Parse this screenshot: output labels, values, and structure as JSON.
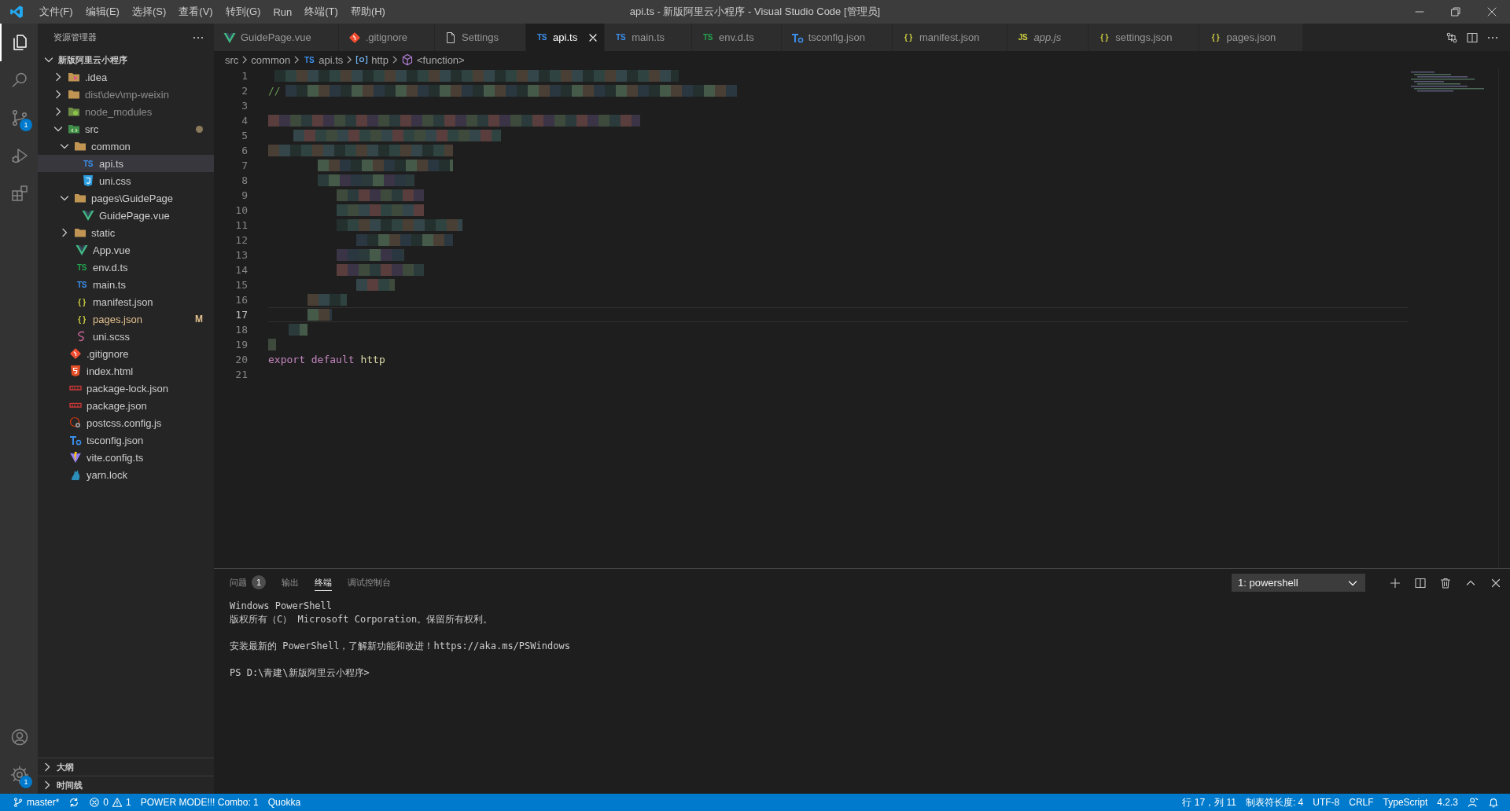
{
  "window": {
    "title": "api.ts - 新版阿里云小程序 - Visual Studio Code [管理员]"
  },
  "menu": [
    "文件(F)",
    "编辑(E)",
    "选择(S)",
    "查看(V)",
    "转到(G)",
    "Run",
    "终端(T)",
    "帮助(H)"
  ],
  "activity_bar": {
    "items": [
      {
        "kind": "explorer",
        "selected": true
      },
      {
        "kind": "search",
        "selected": false
      },
      {
        "kind": "source_control",
        "selected": false,
        "badge": "1"
      },
      {
        "kind": "run_debug",
        "selected": false
      },
      {
        "kind": "extensions",
        "selected": false
      }
    ],
    "bottom": [
      {
        "kind": "account"
      },
      {
        "kind": "settings",
        "badge": "1"
      }
    ]
  },
  "sidebar": {
    "title": "资源管理器",
    "tree": {
      "label": "新版阿里云小程序",
      "expanded": true,
      "selected": false,
      "children": [
        {
          "label": ".idea",
          "icon": {
            "kind": "folder-idea"
          },
          "expanded": false,
          "selected": false
        },
        {
          "label": "dist\\dev\\mp-weixin",
          "icon": {
            "kind": "folder"
          },
          "expanded": false,
          "selected": false,
          "ignored": true
        },
        {
          "label": "node_modules",
          "icon": {
            "kind": "folder-node"
          },
          "expanded": false,
          "selected": false,
          "ignored": true
        },
        {
          "label": "src",
          "icon": {
            "kind": "folder-src"
          },
          "expanded": true,
          "selected": false,
          "has_changes": true,
          "children": [
            {
              "label": "common",
              "icon": {
                "kind": "folder"
              },
              "expanded": true,
              "selected": false,
              "children": [
                {
                  "label": "api.ts",
                  "icon": {
                    "kind": "text",
                    "text": "TS",
                    "color": "#3b8eea"
                  },
                  "selected": true
                },
                {
                  "label": "uni.css",
                  "icon": {
                    "kind": "css"
                  },
                  "selected": false
                }
              ]
            },
            {
              "label": "pages\\GuidePage",
              "icon": {
                "kind": "folder"
              },
              "expanded": true,
              "selected": false,
              "children": [
                {
                  "label": "GuidePage.vue",
                  "icon": {
                    "kind": "vue"
                  },
                  "selected": false
                }
              ]
            },
            {
              "label": "static",
              "icon": {
                "kind": "folder"
              },
              "expanded": false,
              "selected": false
            },
            {
              "label": "App.vue",
              "icon": {
                "kind": "vue"
              },
              "selected": false
            },
            {
              "label": "env.d.ts",
              "icon": {
                "kind": "text",
                "text": "TS",
                "color": "#23a24d"
              },
              "selected": false
            },
            {
              "label": "main.ts",
              "icon": {
                "kind": "text",
                "text": "TS",
                "color": "#3b8eea"
              },
              "selected": false
            },
            {
              "label": "manifest.json",
              "icon": {
                "kind": "text",
                "text": "{ }",
                "color": "#cbcb41"
              },
              "selected": false
            },
            {
              "label": "pages.json",
              "icon": {
                "kind": "text",
                "text": "{ }",
                "color": "#cbcb41"
              },
              "selected": false,
              "modified": true,
              "badge": "M"
            },
            {
              "label": "uni.scss",
              "icon": {
                "kind": "scss"
              },
              "selected": false
            }
          ]
        },
        {
          "label": ".gitignore",
          "icon": {
            "kind": "git"
          },
          "selected": false
        },
        {
          "label": "index.html",
          "icon": {
            "kind": "html"
          },
          "selected": false
        },
        {
          "label": "package-lock.json",
          "icon": {
            "kind": "npm"
          },
          "selected": false
        },
        {
          "label": "package.json",
          "icon": {
            "kind": "npm"
          },
          "selected": false
        },
        {
          "label": "postcss.config.js",
          "icon": {
            "kind": "postcss"
          },
          "selected": false
        },
        {
          "label": "tsconfig.json",
          "icon": {
            "kind": "tsconfig"
          },
          "selected": false
        },
        {
          "label": "vite.config.ts",
          "icon": {
            "kind": "vite"
          },
          "selected": false
        },
        {
          "label": "yarn.lock",
          "icon": {
            "kind": "yarn"
          },
          "selected": false
        }
      ]
    },
    "sections": [
      {
        "label": "大纲",
        "expanded": false
      },
      {
        "label": "时间线",
        "expanded": false
      }
    ]
  },
  "tabs": [
    {
      "label": "GuidePage.vue",
      "icon": {
        "kind": "vue"
      },
      "selected": false,
      "preview": false
    },
    {
      "label": ".gitignore",
      "icon": {
        "kind": "git"
      },
      "selected": false,
      "preview": false
    },
    {
      "label": "Settings",
      "icon": {
        "kind": "file"
      },
      "selected": false,
      "preview": false
    },
    {
      "label": "api.ts",
      "icon": {
        "kind": "text",
        "text": "TS",
        "color": "#3b8eea"
      },
      "selected": true,
      "preview": false
    },
    {
      "label": "main.ts",
      "icon": {
        "kind": "text",
        "text": "TS",
        "color": "#3b8eea"
      },
      "selected": false,
      "preview": false
    },
    {
      "label": "env.d.ts",
      "icon": {
        "kind": "text",
        "text": "TS",
        "color": "#23a24d"
      },
      "selected": false,
      "preview": false
    },
    {
      "label": "tsconfig.json",
      "icon": {
        "kind": "tsconfig"
      },
      "selected": false,
      "preview": false
    },
    {
      "label": "manifest.json",
      "icon": {
        "kind": "text",
        "text": "{ }",
        "color": "#cbcb41"
      },
      "selected": false,
      "preview": false
    },
    {
      "label": "app.js",
      "icon": {
        "kind": "text",
        "text": "JS",
        "color": "#cbcb41"
      },
      "selected": false,
      "preview": true
    },
    {
      "label": "settings.json",
      "icon": {
        "kind": "text",
        "text": "{ }",
        "color": "#cbcb41"
      },
      "selected": false,
      "preview": false
    },
    {
      "label": "pages.json",
      "icon": {
        "kind": "text",
        "text": "{ }",
        "color": "#cbcb41"
      },
      "selected": false,
      "preview": false
    }
  ],
  "breadcrumb": [
    {
      "text": "src"
    },
    {
      "text": "common"
    },
    {
      "text": "api.ts",
      "icon": {
        "kind": "text",
        "text": "TS",
        "color": "#3b8eea"
      }
    },
    {
      "text": "http",
      "icon": {
        "kind": "variable"
      }
    },
    {
      "text": "<function>",
      "icon": {
        "kind": "method"
      }
    }
  ],
  "editor": {
    "lines": [
      {
        "number": "1",
        "current": false
      },
      {
        "number": "2",
        "current": false,
        "tokens": [
          {
            "text": "//",
            "kind": "comment"
          }
        ]
      },
      {
        "number": "3",
        "current": false
      },
      {
        "number": "4",
        "current": false
      },
      {
        "number": "5",
        "current": false
      },
      {
        "number": "6",
        "current": false
      },
      {
        "number": "7",
        "current": false
      },
      {
        "number": "8",
        "current": false
      },
      {
        "number": "9",
        "current": false
      },
      {
        "number": "10",
        "current": false
      },
      {
        "number": "11",
        "current": false
      },
      {
        "number": "12",
        "current": false
      },
      {
        "number": "13",
        "current": false
      },
      {
        "number": "14",
        "current": false
      },
      {
        "number": "15",
        "current": false
      },
      {
        "number": "16",
        "current": false
      },
      {
        "number": "17",
        "current": true
      },
      {
        "number": "18",
        "current": false
      },
      {
        "number": "19",
        "current": false
      },
      {
        "number": "20",
        "current": false,
        "tokens": [
          {
            "text": "export",
            "kind": "keyword"
          },
          {
            "text": "default",
            "kind": "keyword"
          },
          {
            "text": "http",
            "kind": "variable"
          }
        ]
      },
      {
        "number": "21",
        "current": false
      }
    ]
  },
  "panel": {
    "tabs": [
      {
        "label": "问题",
        "badge": "1",
        "selected": false
      },
      {
        "label": "输出",
        "selected": false
      },
      {
        "label": "终端",
        "selected": true
      },
      {
        "label": "调试控制台",
        "selected": false
      }
    ],
    "terminal_select": "1: powershell",
    "terminal": [
      [
        "Windows PowerShell",
        "版权所有（C） Microsoft Corporation。保留所有权利。"
      ],
      [
        "安装最新的 PowerShell，了解新功能和改进！https://aka.ms/PSWindows"
      ],
      [
        "PS D:\\青建\\新版阿里云小程序>"
      ]
    ]
  },
  "status_bar": {
    "left": [
      {
        "kind": "branch",
        "text": "master*"
      },
      {
        "kind": "sync"
      },
      {
        "kind": "problems",
        "errors": "0",
        "warnings": "1"
      },
      {
        "kind": "text",
        "text": "POWER MODE!!! Combo: 1"
      },
      {
        "kind": "text",
        "text": "Quokka"
      }
    ],
    "right": [
      {
        "kind": "text",
        "text": "行 17，列 11"
      },
      {
        "kind": "text",
        "text": "制表符长度: 4"
      },
      {
        "kind": "text",
        "text": "UTF-8"
      },
      {
        "kind": "text",
        "text": "CRLF"
      },
      {
        "kind": "text",
        "text": "TypeScript"
      },
      {
        "kind": "text",
        "text": "4.2.3"
      },
      {
        "kind": "feedback"
      },
      {
        "kind": "notifications"
      }
    ]
  }
}
